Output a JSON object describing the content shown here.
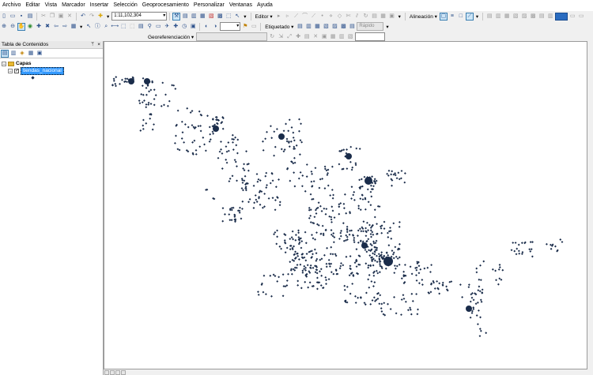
{
  "menubar": {
    "items": [
      "Archivo",
      "Editar",
      "Vista",
      "Marcador",
      "Insertar",
      "Selección",
      "Geoprocesamiento",
      "Personalizar",
      "Ventanas",
      "Ayuda"
    ]
  },
  "toolbar": {
    "scale_value": "1:11,102,304",
    "editor_label": "Editor ▾",
    "alignment_label": "Alineación ▾",
    "labeling_label": "Etiquetado ▾",
    "labeling_mode": "Rápido",
    "georef_label": "Georeferenciación ▾"
  },
  "toc": {
    "title": "Tabla de Contenidos",
    "pin": "ᛘ",
    "close": "×",
    "group_label": "Capas",
    "layer_label": "tiendas_nacional"
  },
  "colors": {
    "point": "#1a2c4a",
    "selection": "#3399ff",
    "folder": "#e8b830"
  }
}
